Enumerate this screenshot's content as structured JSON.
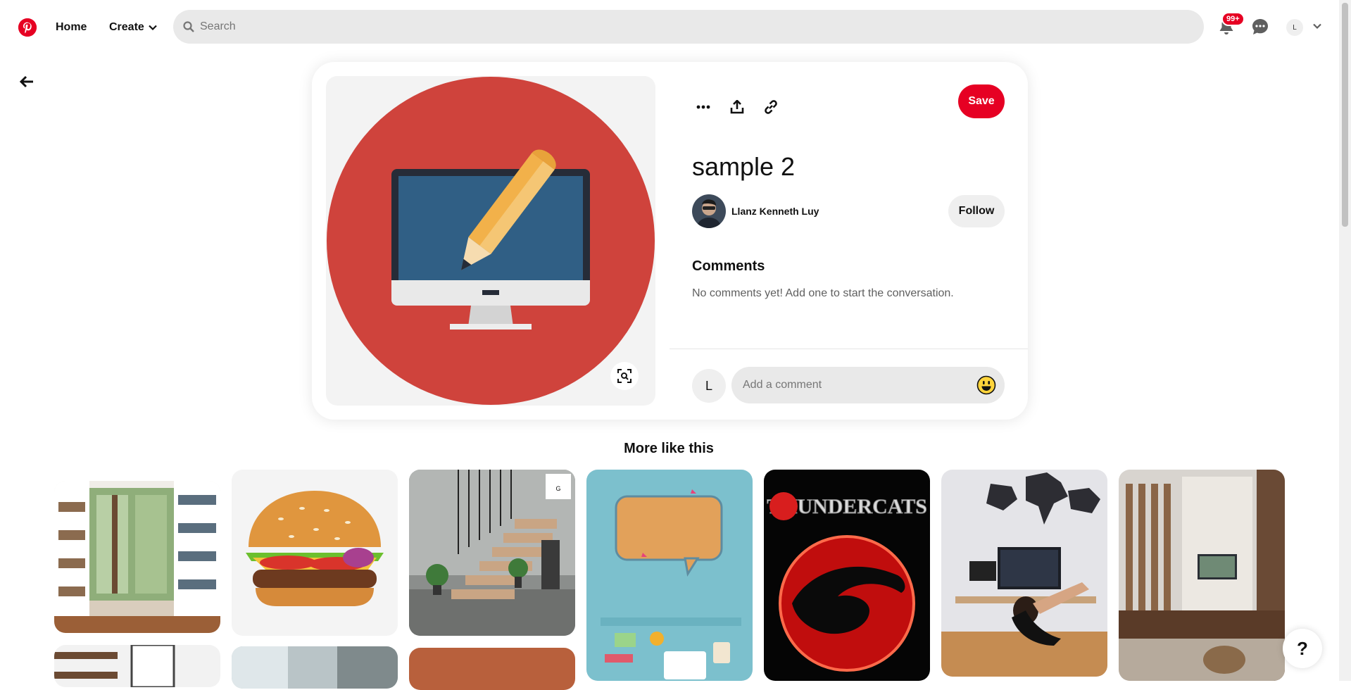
{
  "header": {
    "logo_icon": "pinterest-logo-icon",
    "home_label": "Home",
    "create_label": "Create",
    "search_placeholder": "Search",
    "notification_badge": "99+",
    "account_initial": "L"
  },
  "pin": {
    "title": "sample 2",
    "save_label": "Save",
    "creator_name": "Llanz Kenneth Luy",
    "follow_label": "Follow",
    "comments_heading": "Comments",
    "comments_empty": "No comments yet! Add one to start the conversation.",
    "comment_avatar_initial": "L",
    "comment_placeholder": "Add a comment"
  },
  "more": {
    "title": "More like this",
    "tiles": [
      {
        "subject": "reading nook with bookshelves"
      },
      {
        "subject": "burger illustration"
      },
      {
        "subject": "staircase interior"
      },
      {
        "subject": "speech bubble illustration"
      },
      {
        "subject": "ThunderCats logo",
        "text": "THUNDERCATS"
      },
      {
        "subject": "home office with world map"
      },
      {
        "subject": "living room with tv wall"
      },
      {
        "subject": "shelves interior"
      },
      {
        "subject": "concrete interior"
      },
      {
        "subject": "terracotta wall"
      }
    ]
  },
  "help_label": "?",
  "colors": {
    "brand_red": "#e60023",
    "search_bg": "#e9e9e9",
    "button_gray": "#efefef"
  }
}
